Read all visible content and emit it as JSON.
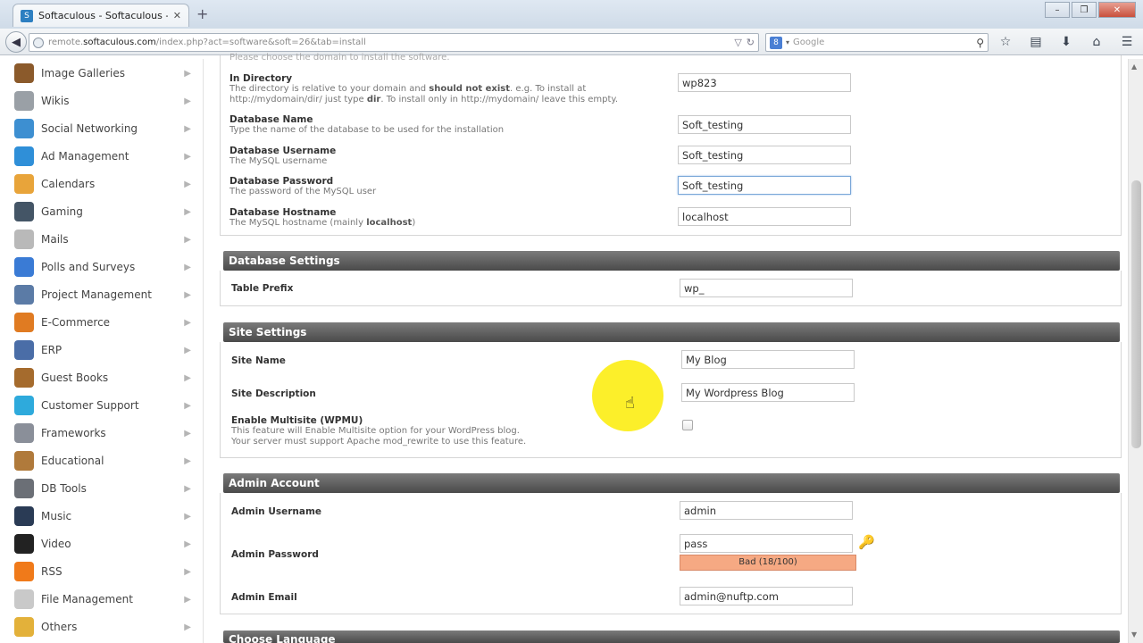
{
  "browser": {
    "tab_title": "Softaculous - Softaculous - W...",
    "url_prefix": "remote.",
    "url_domain": "softaculous.com",
    "url_suffix": "/index.php?act=software&soft=26&tab=install",
    "search_placeholder": "Google"
  },
  "sidebar": {
    "items": [
      {
        "label": "Image Galleries",
        "icon": "image-galleries-icon",
        "color": "#8b5a2b"
      },
      {
        "label": "Wikis",
        "icon": "wikis-icon",
        "color": "#9aa0a6"
      },
      {
        "label": "Social Networking",
        "icon": "social-networking-icon",
        "color": "#3d8fd1"
      },
      {
        "label": "Ad Management",
        "icon": "ad-management-icon",
        "color": "#2f8fd8"
      },
      {
        "label": "Calendars",
        "icon": "calendars-icon",
        "color": "#e8a43a"
      },
      {
        "label": "Gaming",
        "icon": "gaming-icon",
        "color": "#445566"
      },
      {
        "label": "Mails",
        "icon": "mails-icon",
        "color": "#b9b9b9"
      },
      {
        "label": "Polls and Surveys",
        "icon": "polls-icon",
        "color": "#3a7bd5"
      },
      {
        "label": "Project Management",
        "icon": "project-management-icon",
        "color": "#5b7ba6"
      },
      {
        "label": "E-Commerce",
        "icon": "e-commerce-icon",
        "color": "#e07b22"
      },
      {
        "label": "ERP",
        "icon": "erp-icon",
        "color": "#4a6da7"
      },
      {
        "label": "Guest Books",
        "icon": "guest-books-icon",
        "color": "#a56b2d"
      },
      {
        "label": "Customer Support",
        "icon": "customer-support-icon",
        "color": "#2eaadc"
      },
      {
        "label": "Frameworks",
        "icon": "frameworks-icon",
        "color": "#8a8f99"
      },
      {
        "label": "Educational",
        "icon": "educational-icon",
        "color": "#b07a3b"
      },
      {
        "label": "DB Tools",
        "icon": "db-tools-icon",
        "color": "#6b6f76"
      },
      {
        "label": "Music",
        "icon": "music-icon",
        "color": "#2a3b55"
      },
      {
        "label": "Video",
        "icon": "video-icon",
        "color": "#222222"
      },
      {
        "label": "RSS",
        "icon": "rss-icon",
        "color": "#f07a1a"
      },
      {
        "label": "File Management",
        "icon": "file-management-icon",
        "color": "#c9c9c9"
      },
      {
        "label": "Others",
        "icon": "others-icon",
        "color": "#e3b13a"
      }
    ]
  },
  "top_section": {
    "cut_hint": "Please choose the domain to install the software.",
    "in_directory": {
      "label": "In Directory",
      "hint_a": "The directory is relative to your domain and ",
      "hint_b": "should not exist",
      "hint_c": ". e.g. To install at http://mydomain/dir/ just type ",
      "hint_d": "dir",
      "hint_e": ". To install only in http://mydomain/ leave this empty.",
      "value": "wp823"
    },
    "db_name": {
      "label": "Database Name",
      "hint": "Type the name of the database to be used for the installation",
      "value": "Soft_testing"
    },
    "db_user": {
      "label": "Database Username",
      "hint": "The MySQL username",
      "value": "Soft_testing"
    },
    "db_pass": {
      "label": "Database Password",
      "hint": "The password of the MySQL user",
      "value": "Soft_testing"
    },
    "db_host": {
      "label": "Database Hostname",
      "hint_a": "The MySQL hostname (mainly ",
      "hint_b": "localhost",
      "hint_c": ")",
      "value": "localhost"
    }
  },
  "database_settings": {
    "title": "Database Settings",
    "table_prefix": {
      "label": "Table Prefix",
      "value": "wp_"
    }
  },
  "site_settings": {
    "title": "Site Settings",
    "site_name": {
      "label": "Site Name",
      "value": "My Blog"
    },
    "site_desc": {
      "label": "Site Description",
      "value": "My Wordpress Blog"
    },
    "multisite": {
      "label": "Enable Multisite (WPMU)",
      "hint1": "This feature will Enable Multisite option for your WordPress blog.",
      "hint2": "Your server must support Apache mod_rewrite to use this feature.",
      "checked": false
    }
  },
  "admin_account": {
    "title": "Admin Account",
    "username": {
      "label": "Admin Username",
      "value": "admin"
    },
    "password": {
      "label": "Admin Password",
      "value": "pass",
      "strength": "Bad (18/100)"
    },
    "email": {
      "label": "Admin Email",
      "value": "admin@nuftp.com"
    }
  },
  "choose_language": {
    "title": "Choose Language"
  }
}
